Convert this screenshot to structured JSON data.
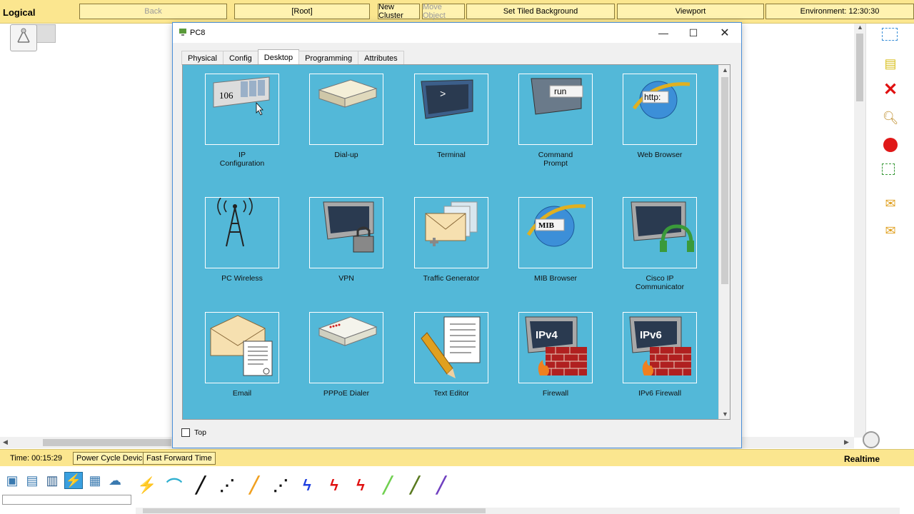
{
  "toolbar": {
    "workspace": "Logical",
    "back": "Back",
    "root": "[Root]",
    "new_cluster": "New Cluster",
    "move_object": "Move Object",
    "tiled_background": "Set Tiled Background",
    "viewport": "Viewport",
    "environment": "Environment: 12:30:30"
  },
  "window": {
    "title": "PC8",
    "tabs": [
      {
        "label": "Physical"
      },
      {
        "label": "Config"
      },
      {
        "label": "Desktop"
      },
      {
        "label": "Programming"
      },
      {
        "label": "Attributes"
      }
    ],
    "active_tab": "Desktop",
    "apps": [
      {
        "label": "IP\nConfiguration",
        "icon": "ip-config-icon"
      },
      {
        "label": "Dial-up",
        "icon": "dialup-modem-icon"
      },
      {
        "label": "Terminal",
        "icon": "terminal-icon"
      },
      {
        "label": "Command\nPrompt",
        "icon": "command-prompt-icon"
      },
      {
        "label": "Web Browser",
        "icon": "web-browser-icon"
      },
      {
        "label": "PC Wireless",
        "icon": "wireless-tower-icon"
      },
      {
        "label": "VPN",
        "icon": "vpn-lock-icon"
      },
      {
        "label": "Traffic Generator",
        "icon": "traffic-generator-icon"
      },
      {
        "label": "MIB Browser",
        "icon": "mib-browser-icon"
      },
      {
        "label": "Cisco IP Communicator",
        "icon": "ip-communicator-icon"
      },
      {
        "label": "Email",
        "icon": "email-icon"
      },
      {
        "label": "PPPoE Dialer",
        "icon": "pppoe-dialer-icon"
      },
      {
        "label": "Text Editor",
        "icon": "text-editor-icon"
      },
      {
        "label": "Firewall",
        "icon": "firewall-icon"
      },
      {
        "label": "IPv6 Firewall",
        "icon": "ipv6-firewall-icon"
      }
    ],
    "icon_text": {
      "ip_number": "106",
      "terminal_prompt": ">",
      "cmd_run": "run",
      "http": "http:",
      "mib": "MIB",
      "ipv4": "IPv4",
      "ipv6": "IPv6"
    },
    "top_checkbox": "Top"
  },
  "status": {
    "time": "Time: 00:15:29",
    "power_cycle": "Power Cycle Devices",
    "fast_forward": "Fast Forward Time",
    "mode": "Realtime"
  },
  "colors": {
    "toolbar_bg": "#fbe68f",
    "desktop_bg": "#53b8d8",
    "window_border": "#4a90d9"
  }
}
